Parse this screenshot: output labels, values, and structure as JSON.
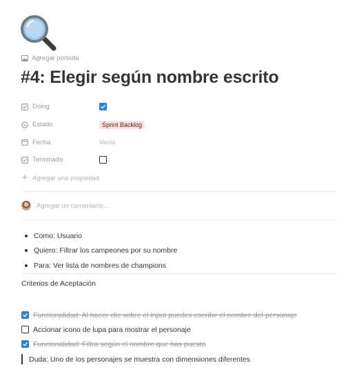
{
  "page": {
    "icon": "magnifying-glass-icon",
    "add_cover_label": "Agregar portada",
    "title": "#4: Elegir según nombre escrito"
  },
  "properties": [
    {
      "name": "Doing",
      "icon": "checkbox-prop-icon",
      "type": "checkbox",
      "checked": true
    },
    {
      "name": "Estado",
      "icon": "status-prop-icon",
      "type": "select",
      "value": "Sprint Backlog",
      "color": "#ffe2dd"
    },
    {
      "name": "Fecha",
      "icon": "calendar-prop-icon",
      "type": "date",
      "value": "Vacío"
    },
    {
      "name": "Terminado",
      "icon": "checkbox-prop-icon",
      "type": "checkbox",
      "checked": false
    }
  ],
  "add_property_label": "Agregar una propiedad",
  "comment_placeholder": "Agregar un comentario...",
  "bullets": [
    "Como: Usuario",
    "Quiero: Filtrar los campeones por su nombre",
    "Para: Ver lista de nombres de champions"
  ],
  "criteria_title": "Criterios de Aceptación",
  "todos": [
    {
      "text": "Funcionalidad: Al hacer clic sobre el input puedes escribir el nombre del personaje",
      "checked": true
    },
    {
      "text": "Accionar icono de lupa para mostrar el personaje",
      "checked": false
    },
    {
      "text": "Funcionalidad: Filtra según el nombre que has puesto",
      "checked": true
    }
  ],
  "quote": "Duda: Uno de los personajes se muestra con dimensiones diferentes",
  "colors": {
    "accent": "#2383e2",
    "tag_bg": "#ffe2dd",
    "text": "#37352f",
    "muted": "#9b9a97"
  }
}
